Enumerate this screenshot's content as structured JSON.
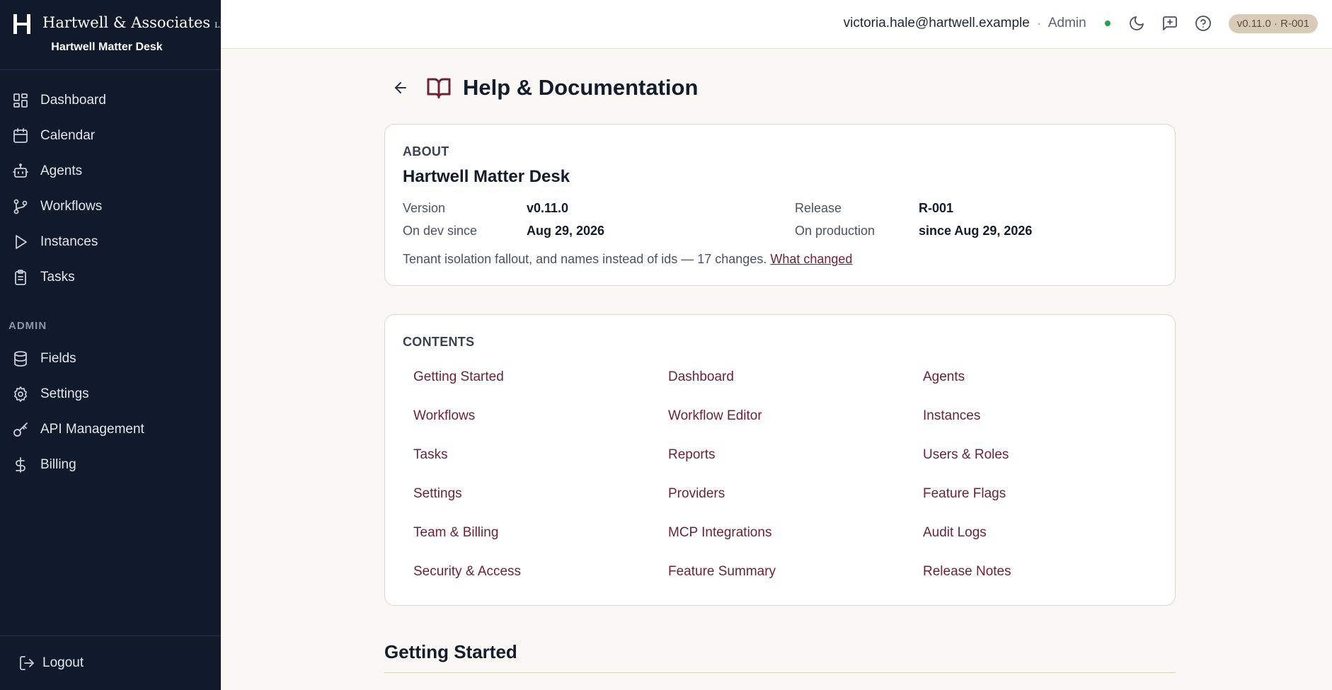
{
  "brand": {
    "name": "Hartwell & Associates",
    "suffix": "LLP",
    "product": "Hartwell Matter Desk"
  },
  "sidebar": {
    "items": [
      {
        "label": "Dashboard",
        "icon": "dashboard-icon"
      },
      {
        "label": "Calendar",
        "icon": "calendar-icon"
      },
      {
        "label": "Agents",
        "icon": "robot-icon"
      },
      {
        "label": "Workflows",
        "icon": "branch-icon"
      },
      {
        "label": "Instances",
        "icon": "play-icon"
      },
      {
        "label": "Tasks",
        "icon": "clipboard-icon"
      }
    ],
    "admin_label": "ADMIN",
    "admin_items": [
      {
        "label": "Fields",
        "icon": "database-icon"
      },
      {
        "label": "Settings",
        "icon": "gear-icon"
      },
      {
        "label": "API Management",
        "icon": "key-icon"
      },
      {
        "label": "Billing",
        "icon": "dollar-icon"
      }
    ],
    "logout": "Logout"
  },
  "topbar": {
    "email": "victoria.hale@hartwell.example",
    "separator": "·",
    "role": "Admin",
    "version_badge": "v0.11.0 · R-001",
    "status_color": "#1fa34a"
  },
  "page": {
    "title": "Help & Documentation"
  },
  "about": {
    "label": "ABOUT",
    "name": "Hartwell Matter Desk",
    "version_label": "Version",
    "version_value": "v0.11.0",
    "release_label": "Release",
    "release_value": "R-001",
    "dev_label": "On dev since",
    "dev_value": "Aug 29, 2026",
    "prod_label": "On production",
    "prod_value": "since Aug 29, 2026",
    "description": "Tenant isolation fallout, and names instead of ids — 17 changes.",
    "link": "What changed"
  },
  "contents": {
    "label": "CONTENTS",
    "links": [
      "Getting Started",
      "Dashboard",
      "Agents",
      "Workflows",
      "Workflow Editor",
      "Instances",
      "Tasks",
      "Reports",
      "Users & Roles",
      "Settings",
      "Providers",
      "Feature Flags",
      "Team & Billing",
      "MCP Integrations",
      "Audit Logs",
      "Security & Access",
      "Feature Summary",
      "Release Notes"
    ]
  },
  "section": {
    "heading": "Getting Started"
  },
  "colors": {
    "sidebar_bg": "#101a2b",
    "accent": "#6a2436",
    "page_bg": "#faf8f4"
  }
}
